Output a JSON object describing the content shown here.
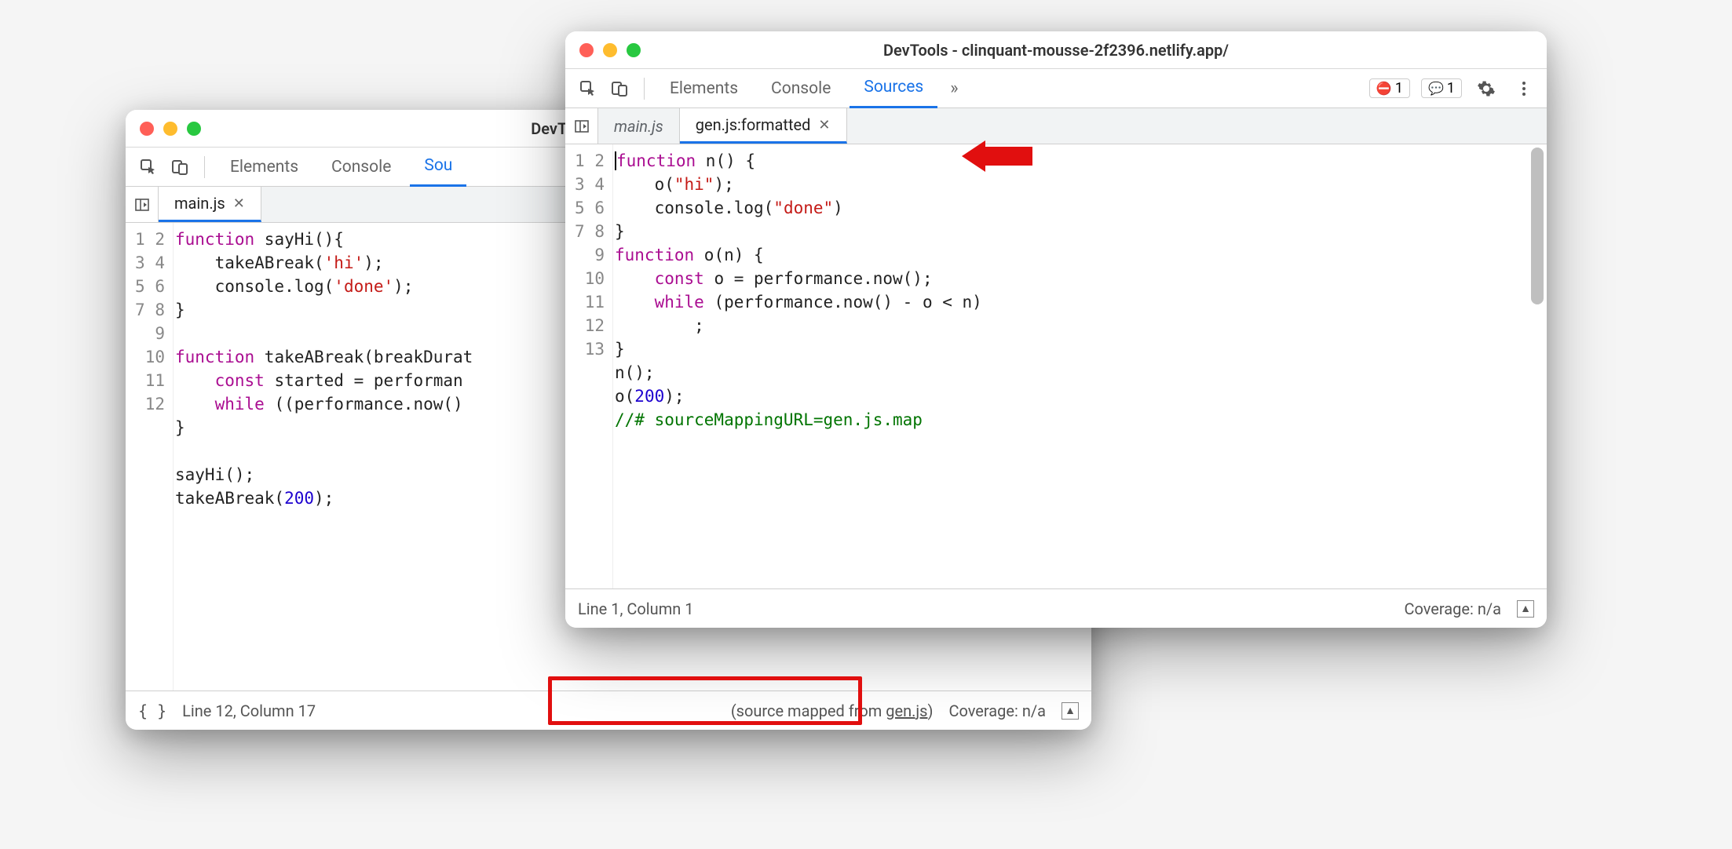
{
  "backWindow": {
    "title": "DevTools - clinquant-r",
    "panelTabs": {
      "elements": "Elements",
      "console": "Console",
      "sources": "Sou"
    },
    "fileTabs": {
      "main": "main.js"
    },
    "gutter": [
      "1",
      "2",
      "3",
      "4",
      "5",
      "6",
      "7",
      "8",
      "9",
      "10",
      "11",
      "12"
    ],
    "code": {
      "l1_a": "function",
      "l1_b": " sayHi(){",
      "l2_a": "    takeABreak(",
      "l2_str": "'hi'",
      "l2_b": ");",
      "l3_a": "    console.log(",
      "l3_str": "'done'",
      "l3_b": ");",
      "l4": "}",
      "l5": "",
      "l6_a": "function",
      "l6_b": " takeABreak(breakDurat",
      "l7_a": "    ",
      "l7_kw": "const",
      "l7_b": " started = performan",
      "l8_a": "    ",
      "l8_kw": "while",
      "l8_b": " ((performance.now()",
      "l9": "}",
      "l10": "",
      "l11": "sayHi();",
      "l12_a": "takeABreak(",
      "l12_num": "200",
      "l12_b": ");"
    },
    "status": {
      "lineCol": "Line 12, Column 17",
      "sourceMappedPrefix": "(source mapped from ",
      "sourceMappedLink": "gen.js",
      "sourceMappedSuffix": ")",
      "coverage": "Coverage: n/a"
    }
  },
  "frontWindow": {
    "title": "DevTools - clinquant-mousse-2f2396.netlify.app/",
    "panelTabs": {
      "elements": "Elements",
      "console": "Console",
      "sources": "Sources"
    },
    "badges": {
      "errors": "1",
      "issues": "1"
    },
    "fileTabs": {
      "main": "main.js",
      "gen": "gen.js:formatted"
    },
    "gutter": [
      "1",
      "2",
      "3",
      "4",
      "5",
      "6",
      "7",
      "8",
      "9",
      "10",
      "11",
      "12",
      "13"
    ],
    "code": {
      "l1_a": "function",
      "l1_b": " n() {",
      "l2_a": "    o(",
      "l2_str": "\"hi\"",
      "l2_b": ");",
      "l3_a": "    console.log(",
      "l3_str": "\"done\"",
      "l3_b": ")",
      "l4": "}",
      "l5_a": "function",
      "l5_b": " o(n) {",
      "l6_a": "    ",
      "l6_kw": "const",
      "l6_b": " o = performance.now();",
      "l7_a": "    ",
      "l7_kw": "while",
      "l7_b": " (performance.now() - o < n)",
      "l8": "        ;",
      "l9": "}",
      "l10": "n();",
      "l11_a": "o(",
      "l11_num": "200",
      "l11_b": ");",
      "l12": "//# sourceMappingURL=gen.js.map",
      "l13": ""
    },
    "status": {
      "lineCol": "Line 1, Column 1",
      "coverage": "Coverage: n/a"
    }
  },
  "moreGlyph": "»"
}
